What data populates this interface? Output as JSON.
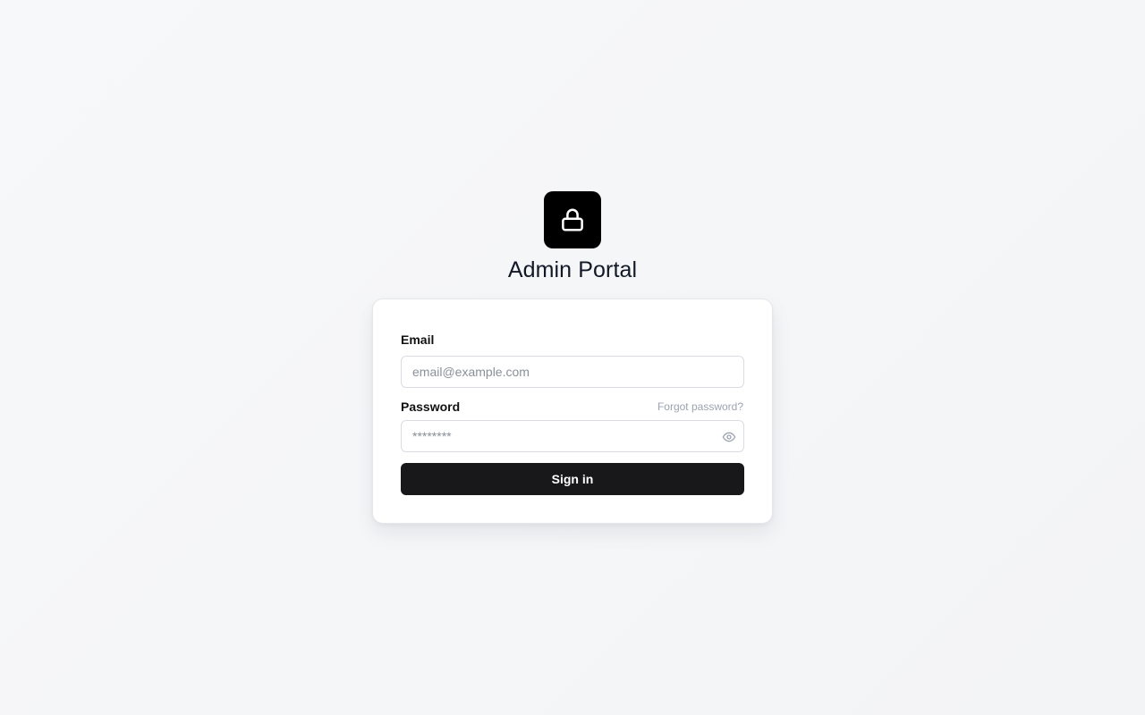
{
  "app": {
    "title": "Admin Portal",
    "logo_icon": "lock-icon",
    "logo_bg": "#000000"
  },
  "form": {
    "email": {
      "label": "Email",
      "value": "",
      "placeholder": "email@example.com"
    },
    "password": {
      "label": "Password",
      "value": "",
      "placeholder": "********",
      "toggle_icon": "eye-icon"
    },
    "forgot_label": "Forgot password?",
    "submit_label": "Sign in",
    "submit_bg": "#18181b"
  }
}
